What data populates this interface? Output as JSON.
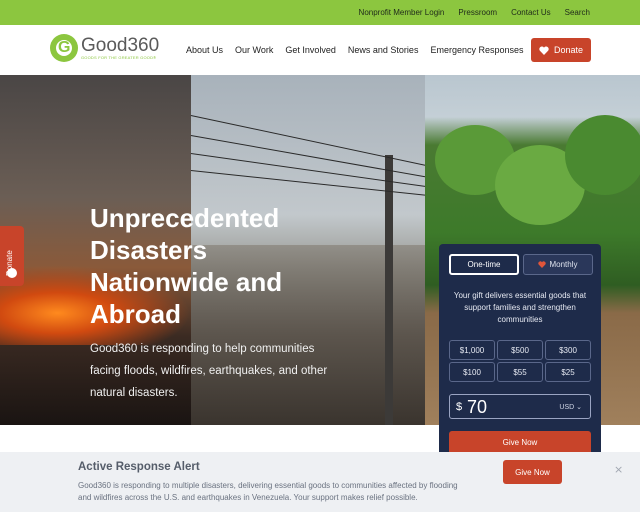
{
  "utility_nav": {
    "items": [
      "Nonprofit Member Login",
      "Pressroom",
      "Contact Us",
      "Search"
    ]
  },
  "header": {
    "logo_name": "Good360",
    "logo_tagline": "GOODS FOR THE GREATER GOOD®",
    "nav": [
      "About Us",
      "Our Work",
      "Get Involved",
      "News and Stories",
      "Emergency Responses"
    ],
    "donate_label": "Donate"
  },
  "hero": {
    "title": "Unprecedented Disasters Nationwide and Abroad",
    "subtitle": "Good360 is responding to help communities facing floods, wildfires, earthquakes, and other natural disasters."
  },
  "side_tab": {
    "label": "Donate"
  },
  "donation_widget": {
    "frequency": {
      "one_time": "One-time",
      "monthly": "Monthly"
    },
    "message": "Your gift delivers essential goods that support families and strengthen communities",
    "amounts": [
      "$1,000",
      "$500",
      "$300",
      "$100",
      "$55",
      "$25"
    ],
    "currency_symbol": "$",
    "amount_value": "70",
    "currency_code": "USD",
    "give_label": "Give Now"
  },
  "alert": {
    "title": "Active Response Alert",
    "body": "Good360 is responding to multiple disasters, delivering essential goods to communities affected by flooding and wildfires across the U.S. and earthquakes in Venezuela. Your support makes relief possible.",
    "button_label": "Give Now",
    "close_glyph": "×"
  },
  "colors": {
    "brand_green": "#8cc63f",
    "donate_red": "#c8442a",
    "widget_navy": "#1e2b4a"
  }
}
